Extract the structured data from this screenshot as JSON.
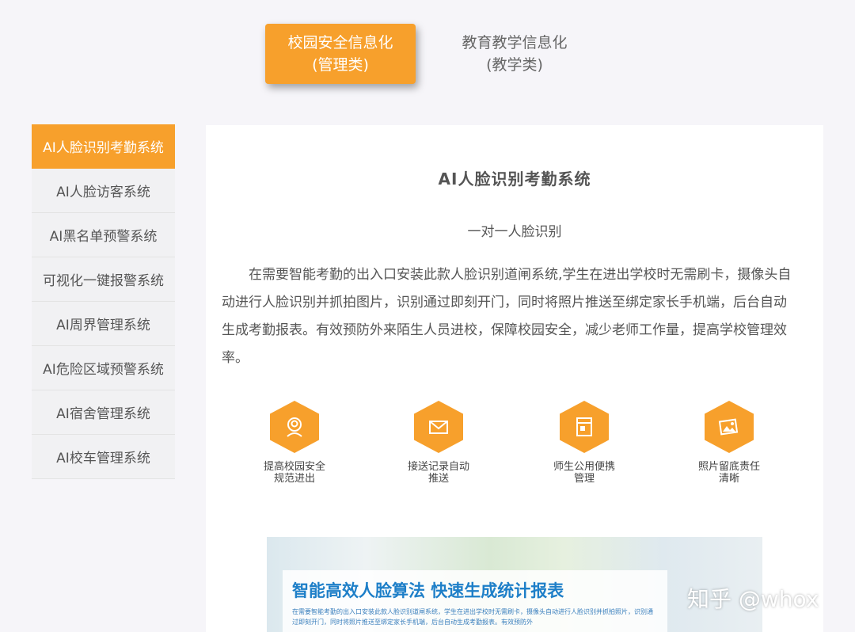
{
  "tabs": {
    "active": {
      "line1": "校园安全信息化",
      "line2": "(管理类)"
    },
    "inactive": {
      "line1": "教育教学信息化",
      "line2": "(教学类)"
    }
  },
  "sidebar": {
    "items": [
      {
        "label": "AI人脸识别考勤系统"
      },
      {
        "label": "AI人脸访客系统"
      },
      {
        "label": "AI黑名单预警系统"
      },
      {
        "label": "可视化一键报警系统"
      },
      {
        "label": "AI周界管理系统"
      },
      {
        "label": "AI危险区域预警系统"
      },
      {
        "label": "AI宿舍管理系统"
      },
      {
        "label": "AI校车管理系统"
      }
    ]
  },
  "main": {
    "title": "AI人脸识别考勤系统",
    "subtitle": "一对一人脸识别",
    "description": "在需要智能考勤的出入口安装此款人脸识别道闸系统,学生在进出学校时无需刷卡，摄像头自动进行人脸识别并抓拍图片，识别通过即刻开门，同时将照片推送至绑定家长手机端，后台自动生成考勤报表。有效预防外来陌生人员进校，保障校园安全，减少老师工作量，提高学校管理效率。",
    "features": [
      {
        "icon": "face-scan-icon",
        "label": "提高校园安全规范进出"
      },
      {
        "icon": "envelope-icon",
        "label": "接送记录自动推送"
      },
      {
        "icon": "tablet-icon",
        "label": "师生公用便携管理"
      },
      {
        "icon": "photo-icon",
        "label": "照片留底责任清晰"
      }
    ],
    "banner": {
      "title": "智能高效人脸算法 快速生成统计报表",
      "text": "在需要智能考勤的出入口安装此款人脸识别道闸系统，学生在进出学校时无需刷卡，摄像头自动进行人脸识别并抓拍照片，识别通过即刻开门，同时将照片推送至绑定家长手机端，后台自动生成考勤报表。有效预防外"
    }
  },
  "watermark": "知乎 @whox",
  "colors": {
    "accent": "#f7a02c",
    "banner_blue": "#1e7fc8"
  }
}
